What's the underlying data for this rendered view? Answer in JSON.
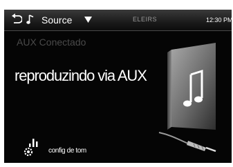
{
  "header": {
    "source_label": "Source",
    "station": "ELEIRS",
    "clock": "12:30 PM",
    "icons": [
      "back-icon",
      "music-note-icon",
      "chevron-down-icon"
    ]
  },
  "main": {
    "title": "AUX Conectado",
    "status": "reproduzindo via AUX",
    "album_art": "music-note-icon",
    "cable": "aux-cable-icon"
  },
  "footer": {
    "tone_label": "config de tom",
    "tone_icon": "tone-settings-icon"
  },
  "colors": {
    "background": "#050505",
    "text": "#ffffff",
    "dim_text": "#4a4a4a"
  }
}
